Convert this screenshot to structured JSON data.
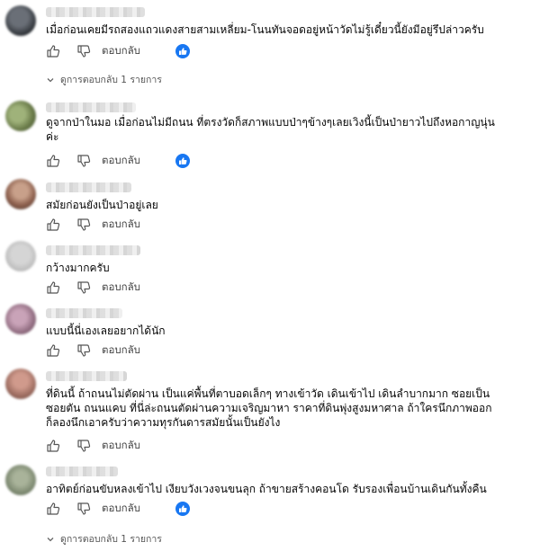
{
  "labels": {
    "reply": "ตอบกลับ",
    "view_replies": "ดูการตอบกลับ 1 รายการ"
  },
  "colors": {
    "like_badge": "#1877F2",
    "muted_text": "#555555"
  },
  "comments": [
    {
      "text": "เมื่อก่อนเคยมีรถสองแถวแดงสายสามเหลี่ยม-โนนทันจอดอยู่หน้าวัดไม่รู้เดี๋ยวนี้ยังมีอยู่รึปล่าวครับ",
      "has_like_reaction": true,
      "reply_count_label": true
    },
    {
      "text": "ดูจากป่าในมอ เมื่อก่อนไม่มีถนน ที่ตรงวัดก็สภาพแบบป่าๆข้างๆเลยเวิงนี้เป็นป่ายาวไปถึงหอกาญนุ่น\nค่ะ",
      "has_like_reaction": true,
      "reply_count_label": false
    },
    {
      "text": "สมัยก่อนยังเป็นป่าอยู่เลย",
      "has_like_reaction": false,
      "reply_count_label": false
    },
    {
      "text": "กว้างมากครับ",
      "has_like_reaction": false,
      "reply_count_label": false
    },
    {
      "text": "แบบนี้นี่เองเลยอยากได้นัก",
      "has_like_reaction": false,
      "reply_count_label": false
    },
    {
      "text": "ที่ดินนี้ ถ้าถนนไม่ตัดผ่าน เป็นแค่พื้นที่ตาบอดเล็กๆ ทางเข้าวัด เดินเข้าไป เดินลำบากมาก ซอยเป็น\nซอยตัน ถนนแคบ ที่นี่ล่ะถนนตัดผ่านความเจริญมาหา ราคาที่ดินพุ่งสูงมหาศาล ถ้าใครนึกภาพออก\nก็ลองนึกเอาครับว่าความทุรกันดารสมัยนั้นเป็นยังไง",
      "has_like_reaction": false,
      "reply_count_label": false
    },
    {
      "text": "อาทิตย์ก่อนขับหลงเข้าไป เงียบวังเวงจนขนลุก ถ้าขายสร้างคอนโด รับรองเพื่อนบ้านเดินกันทั้งคืน",
      "has_like_reaction": true,
      "reply_count_label": true
    }
  ]
}
